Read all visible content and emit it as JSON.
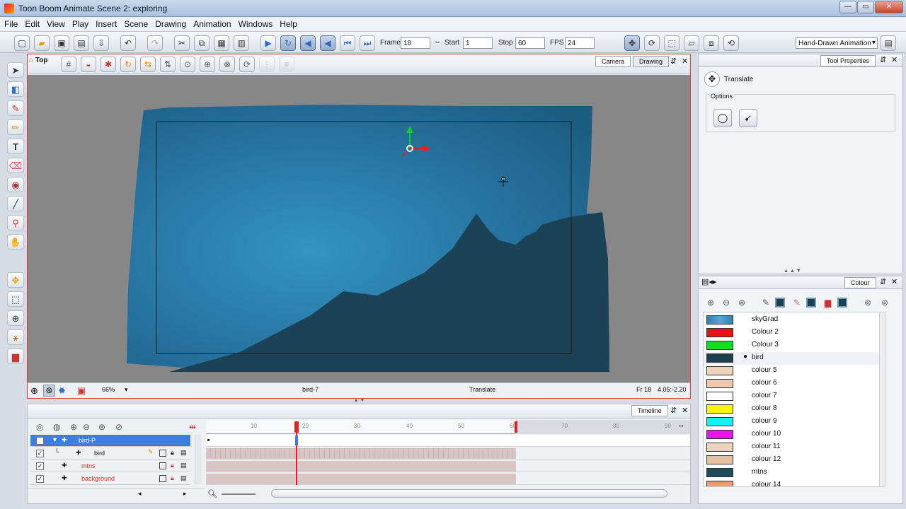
{
  "window": {
    "title": "Toon Boom Animate Scene 2: exploring"
  },
  "menu": [
    "File",
    "Edit",
    "View",
    "Play",
    "Insert",
    "Scene",
    "Drawing",
    "Animation",
    "Windows",
    "Help"
  ],
  "playback": {
    "frame_label": "Frame",
    "frame_value": "18",
    "start_label": "Start",
    "start_value": "1",
    "stop_label": "Stop",
    "stop_value": "60",
    "fps_label": "FPS",
    "fps_value": "24"
  },
  "workspace": {
    "selected": "Hand-Drawn Animation"
  },
  "view": {
    "breadcrumb": "Top",
    "tabs": [
      "Camera",
      "Drawing"
    ],
    "zoom": "66%",
    "current_element": "bird-7",
    "current_tool": "Translate",
    "frame_readout": "Fr 18",
    "coords": "4.05:-2.20"
  },
  "tool_properties": {
    "tab": "Tool Properties",
    "tool_name": "Translate",
    "options_label": "Options"
  },
  "timeline": {
    "tab": "Timeline",
    "ruler": [
      "10",
      "20",
      "30",
      "40",
      "50",
      "60",
      "70",
      "80",
      "90"
    ],
    "current_frame": 18,
    "scene_end": 60,
    "layers": [
      {
        "name": "bird-P",
        "selected": true,
        "color": "#ffffff"
      },
      {
        "name": "bird",
        "selected": false,
        "color": "#111111"
      },
      {
        "name": "mtns",
        "selected": false,
        "color": "#e03020"
      },
      {
        "name": "background",
        "selected": false,
        "color": "#e03020"
      }
    ]
  },
  "colour": {
    "tab": "Colour",
    "swatches": [
      {
        "name": "skyGrad",
        "hex": "#2e7fae"
      },
      {
        "name": "Colour 2",
        "hex": "#ee1111"
      },
      {
        "name": "Colour 3",
        "hex": "#11dd22"
      },
      {
        "name": "bird",
        "hex": "#1c3f4f",
        "selected": true
      },
      {
        "name": "colour 5",
        "hex": "#edd3bb"
      },
      {
        "name": "colour 6",
        "hex": "#edcab0"
      },
      {
        "name": "colour 7",
        "hex": "#ffffff"
      },
      {
        "name": "colour 8",
        "hex": "#f5f50f"
      },
      {
        "name": "colour 9",
        "hex": "#14f2f2"
      },
      {
        "name": "colour 10",
        "hex": "#ee12ee"
      },
      {
        "name": "colour 11",
        "hex": "#ead2bc"
      },
      {
        "name": "colour 12",
        "hex": "#e2c0a0"
      },
      {
        "name": "mtns",
        "hex": "#1e4a5c"
      },
      {
        "name": "colour 14",
        "hex": "#f09a7a"
      }
    ]
  },
  "accent": {
    "sky": "#1e5f80",
    "mountain": "#1b4256",
    "frame_marker": "#e52020"
  }
}
